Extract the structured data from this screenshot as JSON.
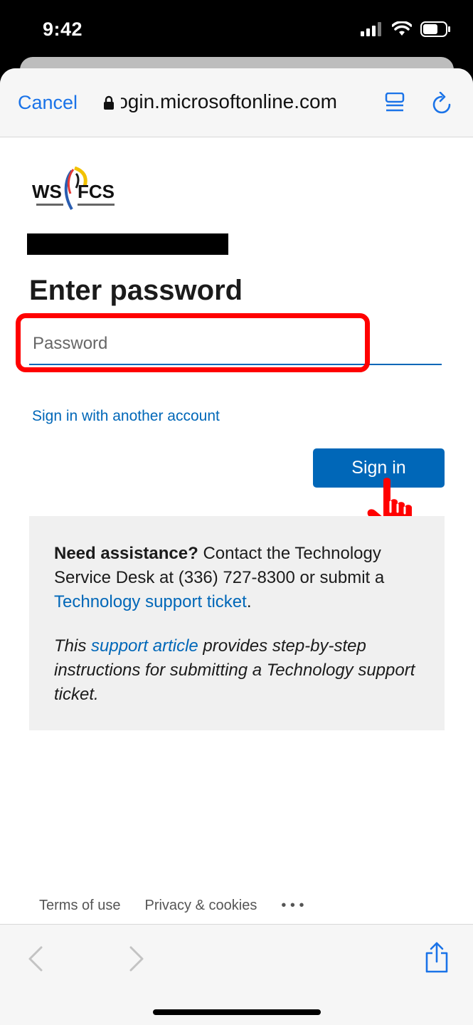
{
  "status_bar": {
    "time": "9:42"
  },
  "browser": {
    "cancel_label": "Cancel",
    "url": "login.microsoftonline.com"
  },
  "page": {
    "logo_text": "WS FCS",
    "title": "Enter password",
    "password_placeholder": "Password",
    "another_account_link": "Sign in with another account",
    "signin_button": "Sign in",
    "assistance": {
      "bold": "Need assistance?",
      "text1": " Contact the Technology Service Desk at (336) 727-8300 or submit a ",
      "link1": "Technology support ticket",
      "text1_end": ".",
      "p2_start": "This ",
      "link2": "support article",
      "p2_end": " provides step-by-step instructions for submitting a Technology support ticket."
    },
    "footer": {
      "terms": "Terms of use",
      "privacy": "Privacy & cookies",
      "more": "• • •"
    }
  },
  "colors": {
    "accent": "#0067b8",
    "highlight": "#ff0000",
    "safari_blue": "#1a73e8"
  }
}
